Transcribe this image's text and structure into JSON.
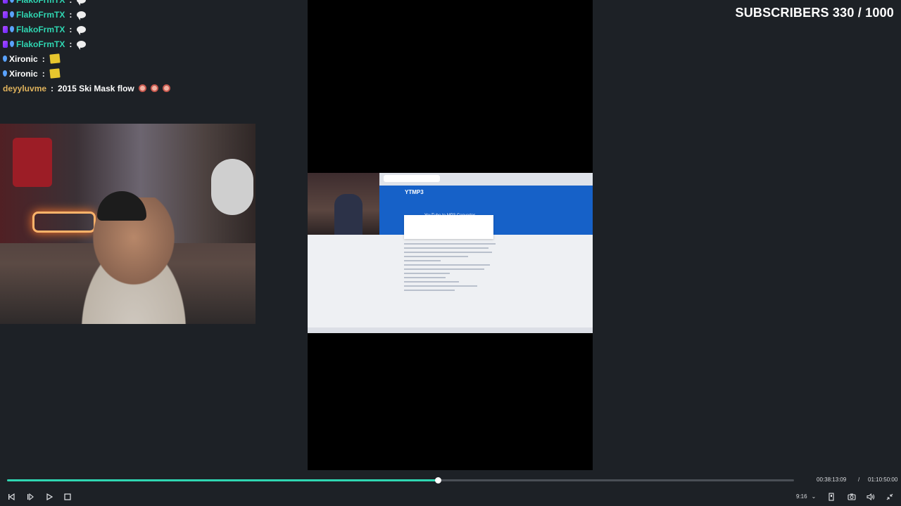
{
  "subscribers": {
    "text": "SUBSCRIBERS 330 / 1000"
  },
  "chat": {
    "messages": [
      {
        "user": "FlakoFrmTX",
        "sep": ":",
        "color": "teal",
        "badges": [
          "sub",
          "drop"
        ],
        "emote": "speech-bubble"
      },
      {
        "user": "FlakoFrmTX",
        "sep": ":",
        "color": "teal",
        "badges": [
          "sub",
          "drop"
        ],
        "emote": "speech-bubble"
      },
      {
        "user": "FlakoFrmTX",
        "sep": ":",
        "color": "teal",
        "badges": [
          "sub",
          "drop"
        ],
        "emote": "speech-bubble"
      },
      {
        "user": "FlakoFrmTX",
        "sep": ":",
        "color": "teal",
        "badges": [
          "sub",
          "drop"
        ],
        "emote": "speech-bubble"
      },
      {
        "user": "Xironic",
        "sep": ":",
        "color": "white",
        "badges": [
          "drop"
        ],
        "emote": "sticky-note"
      },
      {
        "user": "Xironic",
        "sep": ":",
        "color": "white",
        "badges": [
          "drop"
        ],
        "emote": "sticky-note"
      },
      {
        "user": "deyyluvme",
        "sep": ":",
        "color": "gold",
        "badges": [],
        "text": "2015 Ski Mask flow",
        "emote": "faces"
      }
    ]
  },
  "screen": {
    "logo": "YTMP3",
    "heading": "YouTube to MP3 Converter"
  },
  "player": {
    "progress_fraction": 0.5474,
    "time_current": "00:38:13:09",
    "time_sep": "/",
    "time_total": "01:10:50:00",
    "aspect_ratio": "9:16",
    "aspect_chevron": "⌄"
  },
  "icons": {
    "prev": "skip-back-icon",
    "step": "step-forward-icon",
    "play": "play-icon",
    "stop": "stop-icon",
    "bookmark": "bookmark-icon",
    "snapshot": "camera-icon",
    "volume": "volume-icon",
    "collapse": "collapse-icon"
  }
}
